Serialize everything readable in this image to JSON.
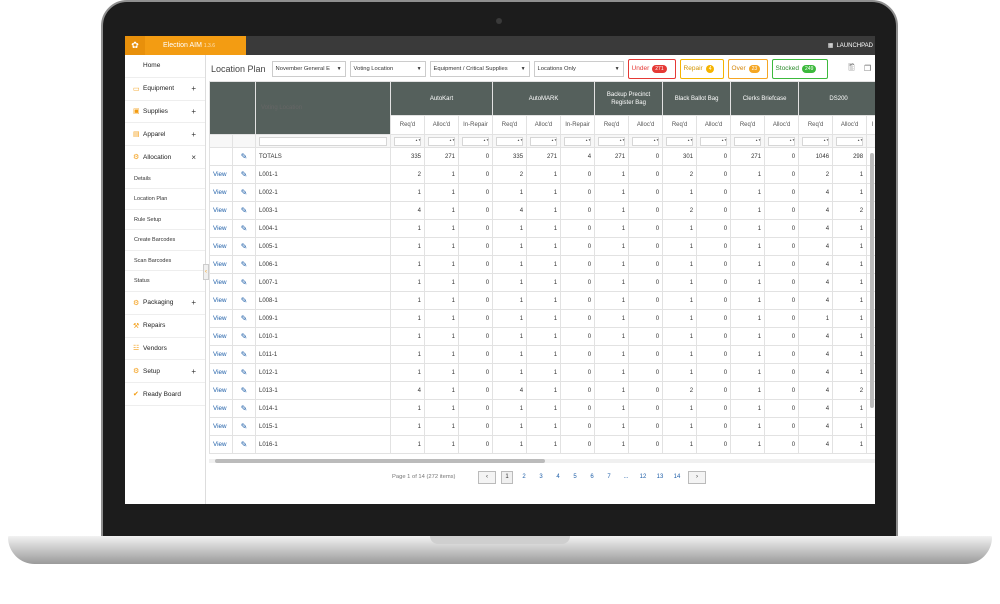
{
  "app": {
    "title": "Election AIM",
    "version": "1.3.6",
    "launchpad": "LAUNCHPAD"
  },
  "sidebar": {
    "items": [
      {
        "label": "Home",
        "icon": "home-icon",
        "pm": ""
      },
      {
        "label": "Equipment",
        "icon": "monitor-icon",
        "pm": "+"
      },
      {
        "label": "Supplies",
        "icon": "box-icon",
        "pm": "+"
      },
      {
        "label": "Apparel",
        "icon": "shirt-icon",
        "pm": "+"
      },
      {
        "label": "Allocation",
        "icon": "gears-icon",
        "pm": "×"
      }
    ],
    "subitems": [
      "Details",
      "Location Plan",
      "Rule Setup",
      "Create Barcodes",
      "Scan Barcodes",
      "Status"
    ],
    "items2": [
      {
        "label": "Packaging",
        "icon": "gears-icon",
        "pm": "+"
      },
      {
        "label": "Repairs",
        "icon": "wrench-icon",
        "pm": ""
      },
      {
        "label": "Vendors",
        "icon": "cart-icon",
        "pm": ""
      },
      {
        "label": "Setup",
        "icon": "gear-icon",
        "pm": "+"
      },
      {
        "label": "Ready Board",
        "icon": "check-icon",
        "pm": ""
      }
    ]
  },
  "toolbar": {
    "title": "Location Plan",
    "election": "November General E",
    "location_type": "Voting Location",
    "category": "Equipment / Critical Supplies",
    "filter": "Locations Only",
    "under_label": "Under",
    "under_count": "271",
    "repair_label": "Repair",
    "repair_count": "4",
    "over_label": "Over",
    "over_count": "23",
    "stocked_label": "Stocked",
    "stocked_count": "249",
    "colors": {
      "under": "#e53935",
      "repair": "#f5b400",
      "over": "#f5a623",
      "stocked": "#3cb93c"
    }
  },
  "grid": {
    "location_header": "Voting Location",
    "groups": [
      "AutoKart",
      "AutoMARK",
      "Backup Precinct Register Bag",
      "Black Ballot Bag",
      "Clerks Briefcase",
      "DS200"
    ],
    "subheaders": [
      "Req'd",
      "Alloc'd",
      "In-Repair",
      "Req'd",
      "Alloc'd",
      "In-Repair",
      "Req'd",
      "Alloc'd",
      "Req'd",
      "Alloc'd",
      "Req'd",
      "Alloc'd",
      "Req'd",
      "Alloc'd",
      "I"
    ],
    "totals": {
      "label": "TOTALS",
      "values": [
        "335",
        "271",
        "0",
        "335",
        "271",
        "4",
        "271",
        "0",
        "301",
        "0",
        "271",
        "0",
        "1046",
        "298",
        ""
      ]
    },
    "view_label": "View",
    "rows": [
      {
        "loc": "L001-1",
        "values": [
          "2",
          "1",
          "0",
          "2",
          "1",
          "0",
          "1",
          "0",
          "2",
          "0",
          "1",
          "0",
          "2",
          "1",
          ""
        ]
      },
      {
        "loc": "L002-1",
        "values": [
          "1",
          "1",
          "0",
          "1",
          "1",
          "0",
          "1",
          "0",
          "1",
          "0",
          "1",
          "0",
          "4",
          "1",
          ""
        ]
      },
      {
        "loc": "L003-1",
        "values": [
          "4",
          "1",
          "0",
          "4",
          "1",
          "0",
          "1",
          "0",
          "2",
          "0",
          "1",
          "0",
          "4",
          "2",
          ""
        ]
      },
      {
        "loc": "L004-1",
        "values": [
          "1",
          "1",
          "0",
          "1",
          "1",
          "0",
          "1",
          "0",
          "1",
          "0",
          "1",
          "0",
          "4",
          "1",
          ""
        ]
      },
      {
        "loc": "L005-1",
        "values": [
          "1",
          "1",
          "0",
          "1",
          "1",
          "0",
          "1",
          "0",
          "1",
          "0",
          "1",
          "0",
          "4",
          "1",
          ""
        ]
      },
      {
        "loc": "L006-1",
        "values": [
          "1",
          "1",
          "0",
          "1",
          "1",
          "0",
          "1",
          "0",
          "1",
          "0",
          "1",
          "0",
          "4",
          "1",
          ""
        ]
      },
      {
        "loc": "L007-1",
        "values": [
          "1",
          "1",
          "0",
          "1",
          "1",
          "0",
          "1",
          "0",
          "1",
          "0",
          "1",
          "0",
          "4",
          "1",
          ""
        ]
      },
      {
        "loc": "L008-1",
        "values": [
          "1",
          "1",
          "0",
          "1",
          "1",
          "0",
          "1",
          "0",
          "1",
          "0",
          "1",
          "0",
          "4",
          "1",
          ""
        ]
      },
      {
        "loc": "L009-1",
        "values": [
          "1",
          "1",
          "0",
          "1",
          "1",
          "0",
          "1",
          "0",
          "1",
          "0",
          "1",
          "0",
          "1",
          "1",
          ""
        ]
      },
      {
        "loc": "L010-1",
        "values": [
          "1",
          "1",
          "0",
          "1",
          "1",
          "0",
          "1",
          "0",
          "1",
          "0",
          "1",
          "0",
          "4",
          "1",
          ""
        ]
      },
      {
        "loc": "L011-1",
        "values": [
          "1",
          "1",
          "0",
          "1",
          "1",
          "0",
          "1",
          "0",
          "1",
          "0",
          "1",
          "0",
          "4",
          "1",
          ""
        ]
      },
      {
        "loc": "L012-1",
        "values": [
          "1",
          "1",
          "0",
          "1",
          "1",
          "0",
          "1",
          "0",
          "1",
          "0",
          "1",
          "0",
          "4",
          "1",
          ""
        ]
      },
      {
        "loc": "L013-1",
        "values": [
          "4",
          "1",
          "0",
          "4",
          "1",
          "0",
          "1",
          "0",
          "2",
          "0",
          "1",
          "0",
          "4",
          "2",
          ""
        ]
      },
      {
        "loc": "L014-1",
        "values": [
          "1",
          "1",
          "0",
          "1",
          "1",
          "0",
          "1",
          "0",
          "1",
          "0",
          "1",
          "0",
          "4",
          "1",
          ""
        ]
      },
      {
        "loc": "L015-1",
        "values": [
          "1",
          "1",
          "0",
          "1",
          "1",
          "0",
          "1",
          "0",
          "1",
          "0",
          "1",
          "0",
          "4",
          "1",
          ""
        ]
      },
      {
        "loc": "L016-1",
        "values": [
          "1",
          "1",
          "0",
          "1",
          "1",
          "0",
          "1",
          "0",
          "1",
          "0",
          "1",
          "0",
          "4",
          "1",
          ""
        ]
      }
    ]
  },
  "pager": {
    "info": "Page 1 of 14 (272 items)",
    "prev": "‹",
    "next": "›",
    "pages": [
      "1",
      "2",
      "3",
      "4",
      "5",
      "6",
      "7",
      "...",
      "12",
      "13",
      "14"
    ],
    "current": "1"
  }
}
